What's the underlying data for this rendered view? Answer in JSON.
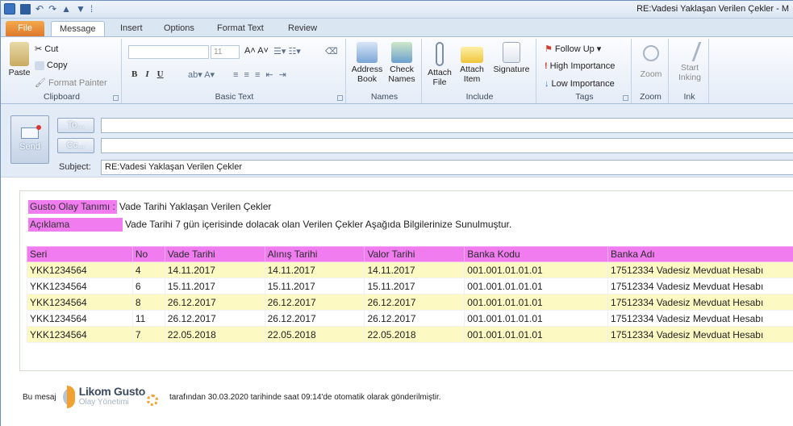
{
  "window": {
    "title": "RE:Vadesi Yaklaşan Verilen Çekler - M"
  },
  "ribbon_tabs": [
    "File",
    "Message",
    "Insert",
    "Options",
    "Format Text",
    "Review"
  ],
  "ribbon": {
    "clipboard": {
      "label": "Clipboard",
      "paste": "Paste",
      "cut": "Cut",
      "copy": "Copy",
      "format_painter": "Format Painter"
    },
    "basic_text": {
      "label": "Basic Text",
      "font_size": "11"
    },
    "names": {
      "label": "Names",
      "address_book": "Address Book",
      "check_names": "Check Names"
    },
    "include": {
      "label": "Include",
      "attach_file": "Attach File",
      "attach_item": "Attach Item",
      "signature": "Signature"
    },
    "tags": {
      "label": "Tags",
      "follow_up": "Follow Up",
      "high_importance": "High Importance",
      "low_importance": "Low Importance"
    },
    "zoom": {
      "label": "Zoom",
      "zoom": "Zoom"
    },
    "ink": {
      "label": "Ink",
      "start_inking": "Start Inking"
    }
  },
  "header": {
    "send": "Send",
    "to_button": "To...",
    "cc_button": "Cc...",
    "to_value": "",
    "cc_value": "",
    "subject_label": "Subject:",
    "subject_value": "RE:Vadesi Yaklaşan Verilen Çekler"
  },
  "message": {
    "event_label": "Gusto Olay Tanımı :",
    "event_value": "Vade Tarihi Yaklaşan Verilen Çekler",
    "desc_label": "Açıklama",
    "desc_value": "Vade Tarihi 7 gün içerisinde dolacak olan Verilen Çekler Aşağıda Bilgilerinize Sunulmuştur.",
    "columns": [
      "Seri",
      "No",
      "Vade Tarihi",
      "Alınış Tarihi",
      "Valor Tarihi",
      "Banka Kodu",
      "Banka Adı"
    ],
    "rows": [
      [
        "YKK1234564",
        "4",
        "14.11.2017",
        "14.11.2017",
        "14.11.2017",
        "001.001.01.01.01",
        "17512334 Vadesiz Mevduat Hesabı"
      ],
      [
        "YKK1234564",
        "6",
        "15.11.2017",
        "15.11.2017",
        "15.11.2017",
        "001.001.01.01.01",
        "17512334 Vadesiz Mevduat Hesabı"
      ],
      [
        "YKK1234564",
        "8",
        "26.12.2017",
        "26.12.2017",
        "26.12.2017",
        "001.001.01.01.01",
        "17512334 Vadesiz Mevduat Hesabı"
      ],
      [
        "YKK1234564",
        "11",
        "26.12.2017",
        "26.12.2017",
        "26.12.2017",
        "001.001.01.01.01",
        "17512334 Vadesiz Mevduat Hesabı"
      ],
      [
        "YKK1234564",
        "7",
        "22.05.2018",
        "22.05.2018",
        "22.05.2018",
        "001.001.01.01.01",
        "17512334 Vadesiz Mevduat Hesabı"
      ]
    ],
    "footer_prefix": "Bu mesaj",
    "footer_suffix": "tarafından 30.03.2020 tarihinde saat 09:14'de otomatik olarak gönderilmiştir.",
    "logo_brand": "Likom Gusto",
    "logo_tagline": "Olay Yönetimi"
  },
  "colors": {
    "header_fill": "#f07cf0",
    "row_highlight": "#fdf9c3",
    "file_tab": "#e0782c"
  }
}
